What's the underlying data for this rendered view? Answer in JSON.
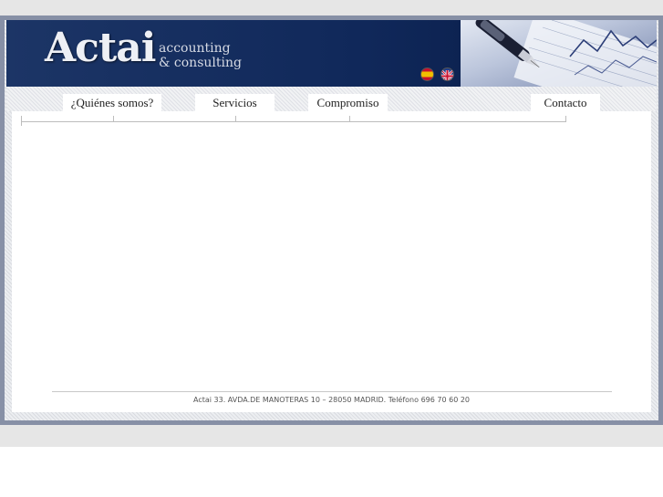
{
  "header": {
    "logo_name": "Actai",
    "logo_tagline_1": "accounting",
    "logo_tagline_2": "& consulting"
  },
  "languages": [
    {
      "icon": "spain-flag-icon"
    },
    {
      "icon": "uk-flag-icon"
    }
  ],
  "nav": {
    "items": [
      {
        "label": "¿Quiénes somos?"
      },
      {
        "label": "Servicios"
      },
      {
        "label": "Compromiso"
      },
      {
        "label": "Contacto"
      }
    ]
  },
  "footer": {
    "text": "Actai 33. AVDA.DE MANOTERAS 10 – 28050 MADRID. Teléfono 696 70 60 20"
  },
  "colors": {
    "header_blue": "#10285a",
    "frame": "#8790a6",
    "band": "#e6e6e6"
  }
}
